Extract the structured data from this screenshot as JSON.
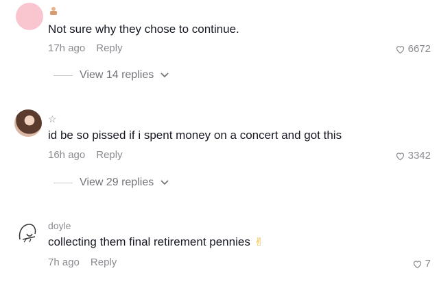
{
  "comments": [
    {
      "username": "",
      "text": "Not sure why they chose to continue.",
      "time": "17h ago",
      "reply_label": "Reply",
      "likes": "6672",
      "view_replies": "View 14 replies"
    },
    {
      "username": "☆",
      "text": "id be so pissed if i spent money on a concert and got this",
      "time": "16h ago",
      "reply_label": "Reply",
      "likes": "3342",
      "view_replies": "View 29 replies"
    },
    {
      "username": "doyle",
      "text": "collecting them final retirement pennies",
      "time": "7h ago",
      "reply_label": "Reply",
      "likes": "7",
      "emoji": "✌"
    }
  ],
  "colors": {
    "text": "#161823",
    "muted": "#8a8b91",
    "pink_avatar": "#f9c6d0"
  },
  "icons": [
    "heart-outline-icon",
    "chevron-down-icon",
    "emoji-badge-icon",
    "victory-hand-emoji"
  ]
}
